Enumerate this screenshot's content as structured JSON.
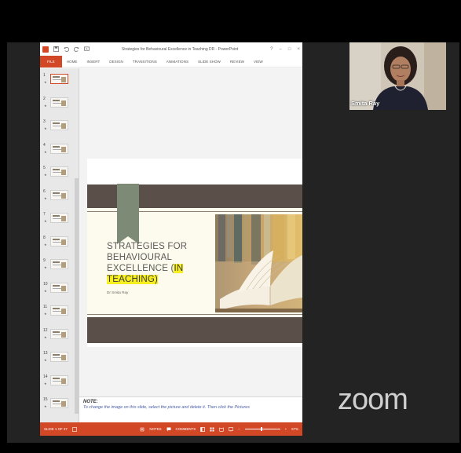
{
  "powerpoint": {
    "doc_title": "Strategies for Behavioural Excellence in Teaching DR - PowerPoint",
    "window_controls": [
      "?",
      "–",
      "□",
      "×"
    ],
    "ribbon_tabs": [
      "FILE",
      "HOME",
      "INSERT",
      "DESIGN",
      "TRANSITIONS",
      "ANIMATIONS",
      "SLIDE SHOW",
      "REVIEW",
      "VIEW"
    ],
    "thumbnails": [
      {
        "num": "1"
      },
      {
        "num": "2"
      },
      {
        "num": "3"
      },
      {
        "num": "4"
      },
      {
        "num": "5"
      },
      {
        "num": "6"
      },
      {
        "num": "7"
      },
      {
        "num": "8"
      },
      {
        "num": "9"
      },
      {
        "num": "10"
      },
      {
        "num": "11"
      },
      {
        "num": "12"
      },
      {
        "num": "13"
      },
      {
        "num": "14"
      },
      {
        "num": "15"
      }
    ],
    "slide": {
      "title_line1": "STRATEGIES FOR",
      "title_line2": "BEHAVIOURAL",
      "title_line3_plain": "EXCELLENCE (",
      "title_line3_hl": "IN",
      "title_line4_hl": "TEACHING)",
      "author": "Dr Smita Ray"
    },
    "notes": {
      "heading": "NOTE:",
      "text": "To change the image on this slide, select the picture and delete it. Then click the Pictures"
    },
    "status": {
      "slide_count": "SLIDE 1 OF 37",
      "notes_label": "NOTES",
      "comments_label": "COMMENTS",
      "zoom": "67%"
    },
    "colors": {
      "accent": "#d24726",
      "band": "#5b5049",
      "highlight": "#f7ef1f",
      "bookmark": "#7d8a76"
    }
  },
  "participant": {
    "name": "Smita Ray"
  },
  "zoom_brand": "zoom"
}
